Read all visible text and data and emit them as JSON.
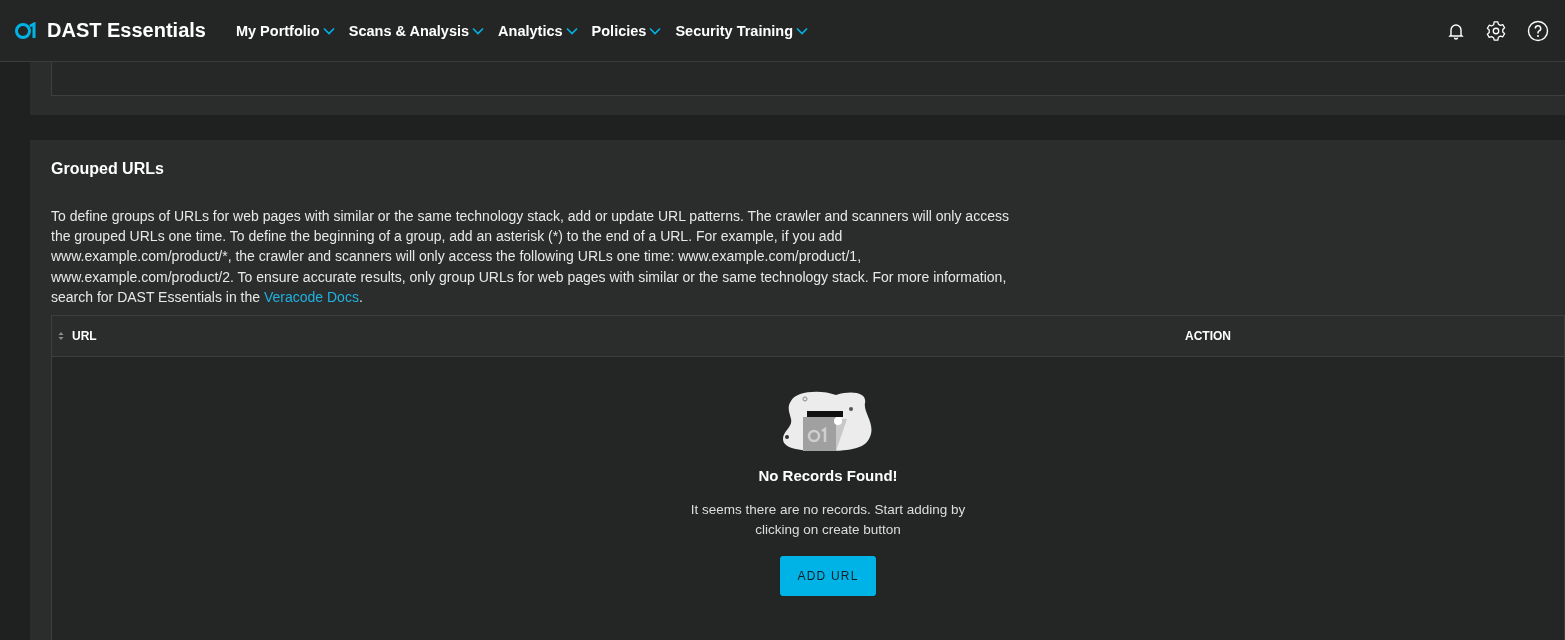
{
  "header": {
    "app_name": "DAST Essentials",
    "nav": [
      {
        "label": "My Portfolio"
      },
      {
        "label": "Scans & Analysis"
      },
      {
        "label": "Analytics"
      },
      {
        "label": "Policies"
      },
      {
        "label": "Security Training"
      }
    ]
  },
  "section": {
    "title": "Grouped URLs",
    "description": {
      "text": "To define groups of URLs for web pages with similar or the same technology stack, add or update URL patterns. The crawler and scanners will only access the grouped URLs one time. To define the beginning of a group, add an asterisk (*) to the end of a URL. For example, if you add www.example.com/product/*, the crawler and scanners will only access the following URLs one time: www.example.com/product/1, www.example.com/product/2. To ensure accurate results, only group URLs for web pages with similar or the same technology stack. For more information, search for DAST Essentials in the ",
      "link": "Veracode Docs",
      "after": "."
    },
    "table": {
      "columns": [
        {
          "label": "URL",
          "sortable": true
        },
        {
          "label": "ACTION",
          "sortable": false
        }
      ],
      "empty": {
        "title": "No Records Found!",
        "message": "It seems there are no records. Start adding by clicking on create button",
        "button": "ADD URL"
      }
    }
  }
}
